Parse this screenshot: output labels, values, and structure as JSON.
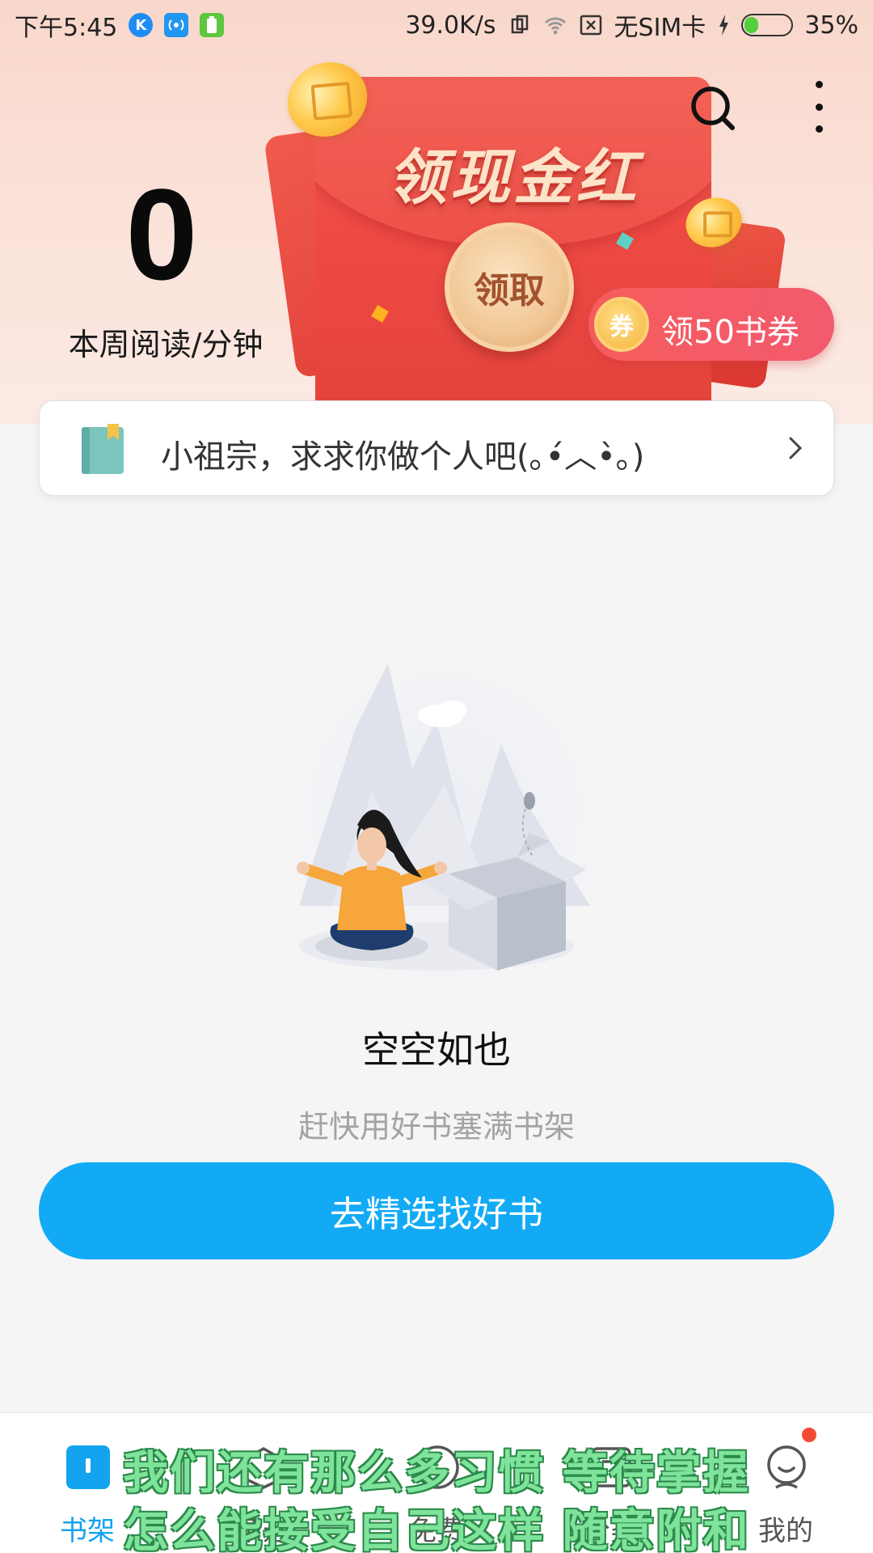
{
  "status_bar": {
    "time": "下午5:45",
    "speed": "39.0K/s",
    "sim": "无SIM卡",
    "battery": "35%",
    "battery_level": 0.35
  },
  "reading": {
    "minutes": "0",
    "label": "本周阅读/分钟"
  },
  "banner": {
    "title": "领现金红包",
    "claim_label": "领取",
    "voucher_badge": "券",
    "voucher_label": "领50书券"
  },
  "notice": {
    "text": "小祖宗，求求你做个人吧(｡•́︿•̀｡)"
  },
  "empty_state": {
    "title": "空空如也",
    "subtitle": "赶快用好书塞满书架",
    "cta": "去精选找好书"
  },
  "bottom_nav": {
    "items": [
      {
        "label": "书架",
        "icon": "bookshelf-icon",
        "active": true
      },
      {
        "label": "精选",
        "icon": "featured-icon",
        "active": false
      },
      {
        "label": "免费",
        "icon": "free-icon",
        "active": false
      },
      {
        "label": "分类",
        "icon": "category-icon",
        "active": false
      },
      {
        "label": "我的",
        "icon": "profile-icon",
        "active": false
      }
    ]
  },
  "overlay_lyrics": {
    "line1": "我们还有那么多习惯 等待掌握",
    "line2": "怎么能接受自己这样 随意附和"
  },
  "colors": {
    "accent": "#12aaf5",
    "envelope_red": "#ef4a44",
    "lyric_green": "#7fe39b"
  }
}
